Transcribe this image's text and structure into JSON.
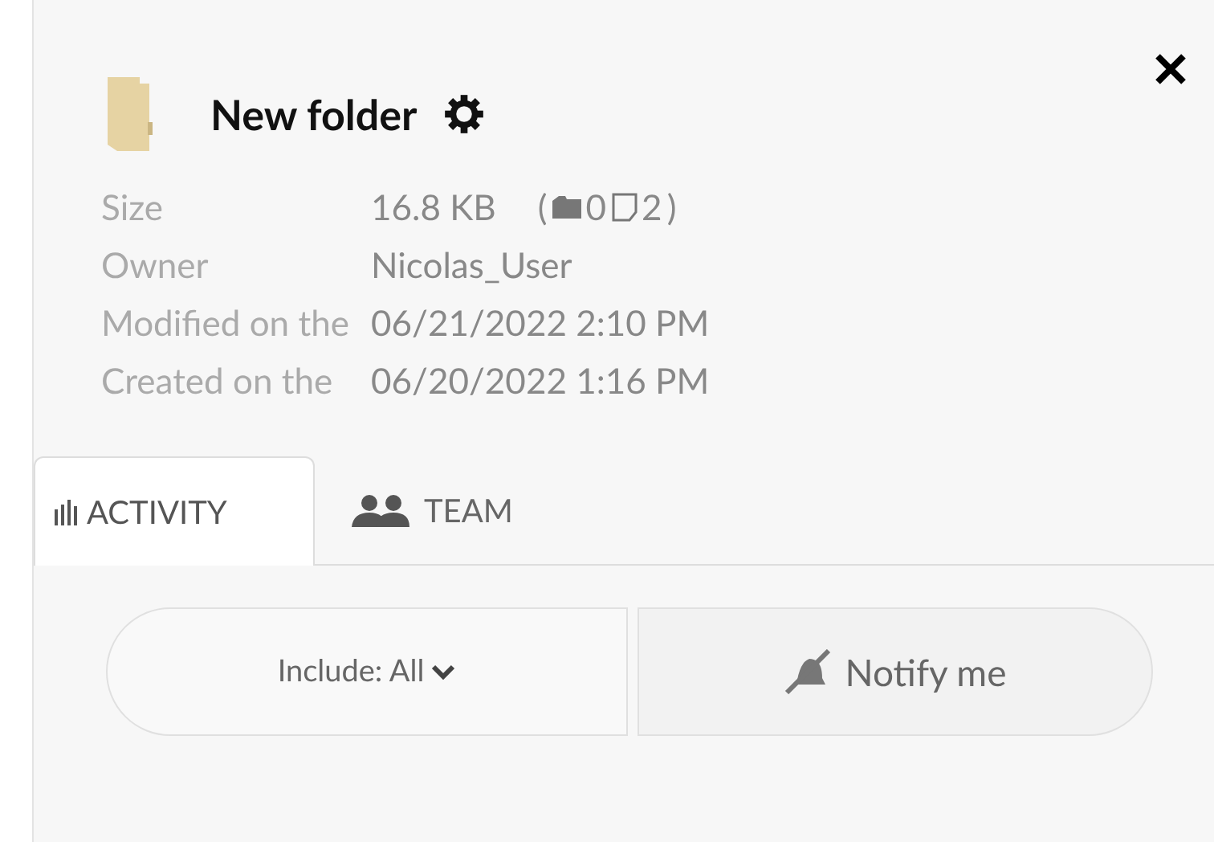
{
  "title": "New folder",
  "details": [
    {
      "label": "Size",
      "value": "16.8 KB",
      "counts": {
        "open": "(",
        "folders": "0",
        "files": "2",
        "close": ")"
      }
    },
    {
      "label": "Owner",
      "value": "Nicolas_User"
    },
    {
      "label": "Modified on the",
      "value": "06/21/2022 2:10 PM"
    },
    {
      "label": "Created on the",
      "value": "06/20/2022 1:16 PM"
    }
  ],
  "tabs": [
    {
      "label": "ACTIVITY",
      "kind": "activity",
      "selected": true
    },
    {
      "label": "TEAM",
      "kind": "team",
      "selected": false
    }
  ],
  "include_filter": "Include: All",
  "notify_button": "Notify me"
}
